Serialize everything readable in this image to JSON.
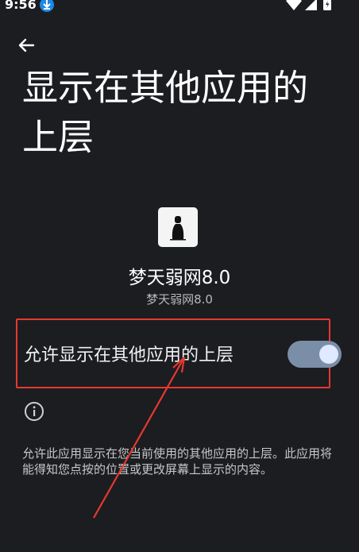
{
  "status_bar": {
    "time": "9:56",
    "icons": [
      "download-icon",
      "wifi-icon",
      "signal-icon",
      "battery-icon"
    ]
  },
  "header": {
    "title": "显示在其他应用的上层"
  },
  "app": {
    "name": "梦天弱网8.0",
    "version": "梦天弱网8.0"
  },
  "permission": {
    "label": "允许显示在其他应用的上层",
    "enabled": true
  },
  "info": {
    "description": "允许此应用显示在您当前使用的其他应用的上层。此应用将能得知您点按的位置或更改屏幕上显示的内容。"
  },
  "colors": {
    "background": "#1c1d21",
    "toggle_track": "#7b8ea8",
    "toggle_thumb": "#dfe9ff",
    "highlight_box": "#e6382f"
  }
}
